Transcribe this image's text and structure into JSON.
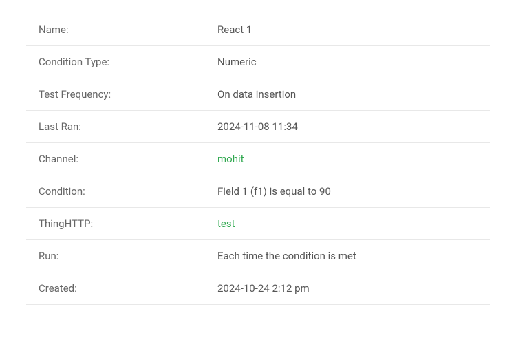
{
  "details": {
    "name_label": "Name:",
    "name_value": "React 1",
    "condition_type_label": "Condition Type:",
    "condition_type_value": "Numeric",
    "test_frequency_label": "Test Frequency:",
    "test_frequency_value": "On data insertion",
    "last_ran_label": "Last Ran:",
    "last_ran_value": "2024-11-08 11:34",
    "channel_label": "Channel:",
    "channel_value": "mohit",
    "condition_label": "Condition:",
    "condition_value": "Field 1 (f1) is equal to 90",
    "thinghttp_label": "ThingHTTP:",
    "thinghttp_value": "test",
    "run_label": "Run:",
    "run_value": "Each time the condition is met",
    "created_label": "Created:",
    "created_value": "2024-10-24 2:12 pm"
  }
}
